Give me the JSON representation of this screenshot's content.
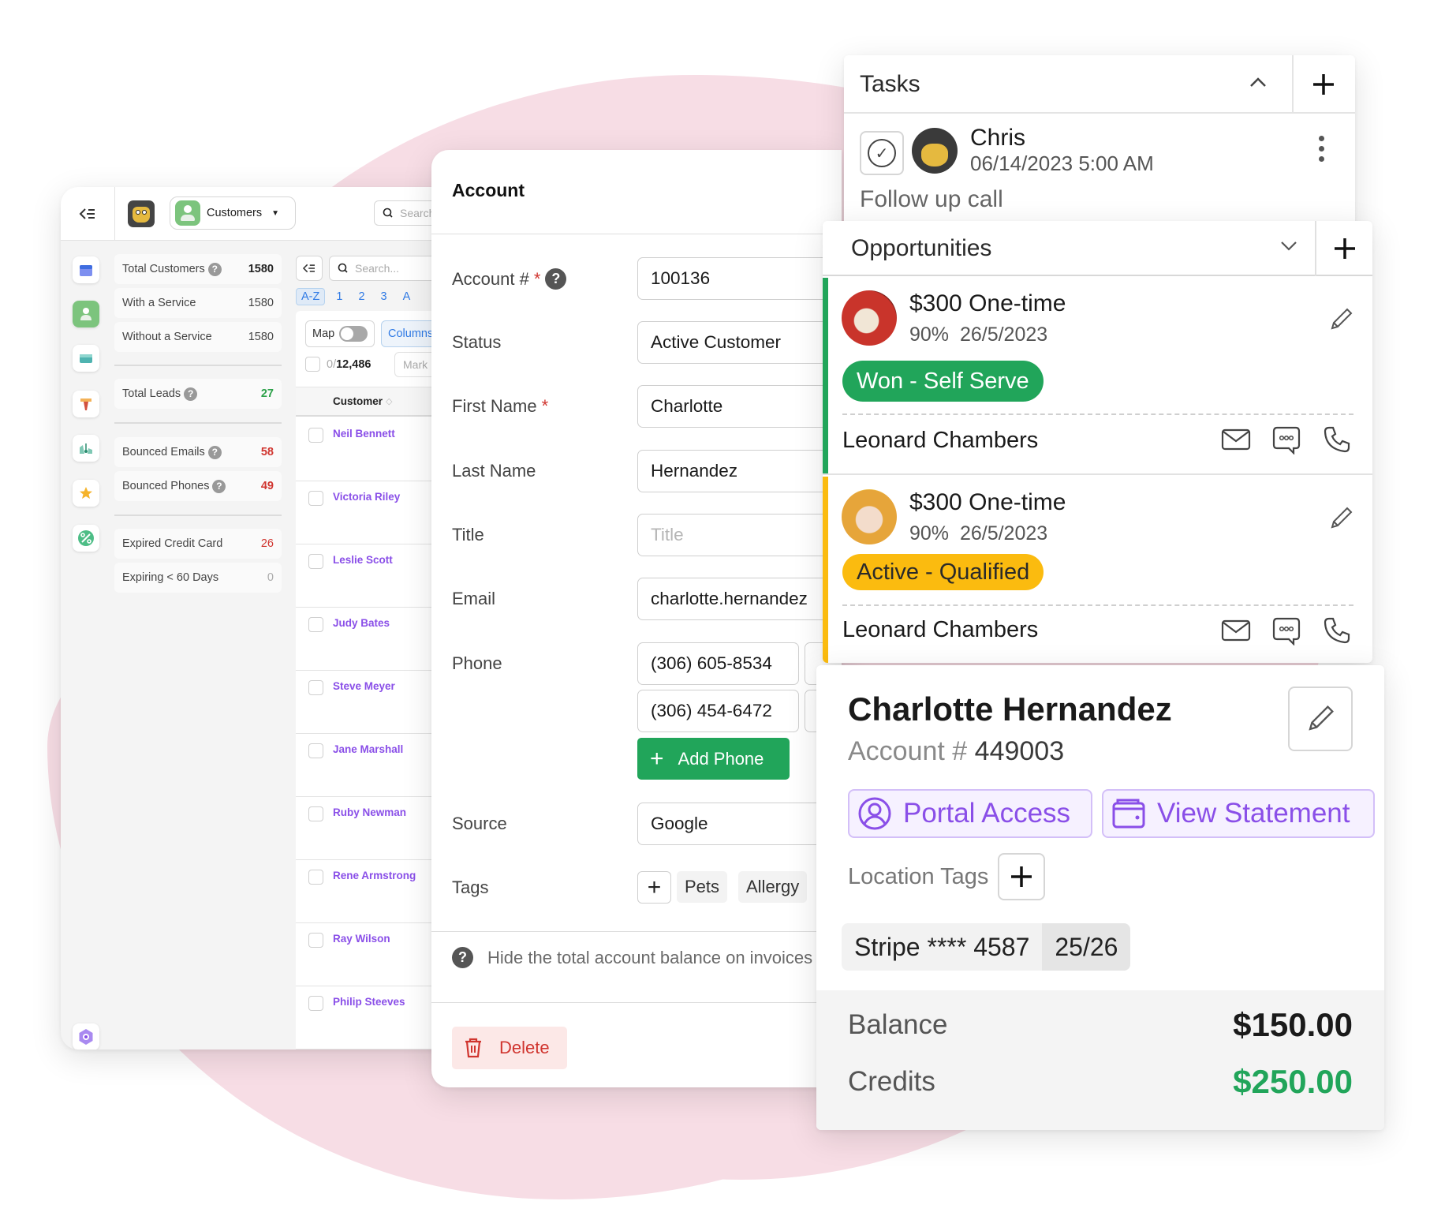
{
  "colors": {
    "accent_purple": "#8a4fe8",
    "success_green": "#21a55a",
    "warning_yellow": "#fbbb0f",
    "danger_red": "#d0352f",
    "link_blue": "#2f7ae5",
    "background_blob": "#f7dde5"
  },
  "left_panel": {
    "collapse_icon": "collapse-left-icon",
    "logo_icon": "gorilla-logo-icon",
    "module_selector": {
      "label": "Customers",
      "icon": "customer-icon",
      "caret": "▼"
    },
    "top_search": {
      "placeholder": "Search"
    },
    "sidebar_icons": [
      {
        "name": "calendar-icon"
      },
      {
        "name": "customers-icon",
        "active": true
      },
      {
        "name": "inbox-icon"
      },
      {
        "name": "funnel-icon"
      },
      {
        "name": "reports-icon"
      },
      {
        "name": "star-icon"
      },
      {
        "name": "percent-icon"
      },
      {
        "name": "settings-icon"
      },
      {
        "name": "tools-icon"
      }
    ],
    "stats": [
      {
        "label": "Total Customers",
        "help": true,
        "value": "1580"
      },
      {
        "label": "With a Service",
        "help": false,
        "value": "1580"
      },
      {
        "label": "Without a Service",
        "help": false,
        "value": "1580"
      },
      {
        "label": "Total Leads",
        "help": true,
        "value": "27"
      },
      {
        "label": "Bounced Emails",
        "help": true,
        "value": "58"
      },
      {
        "label": "Bounced Phones",
        "help": true,
        "value": "49"
      },
      {
        "label": "Expired Credit Card",
        "help": false,
        "value": "26"
      },
      {
        "label": "Expiring < 60 Days",
        "help": false,
        "value": "0"
      }
    ],
    "list": {
      "search_placeholder": "Search...",
      "alpha_filters": [
        "A-Z",
        "1",
        "2",
        "3",
        "A"
      ],
      "map_label": "Map",
      "map_toggle_on": false,
      "columns_label": "Columns",
      "selected_count": "0",
      "total_count": "12,486",
      "mark_label": "Mark",
      "column_header": "Customer",
      "customers": [
        "Neil Bennett",
        "Victoria Riley",
        "Leslie Scott",
        "Judy Bates",
        "Steve Meyer",
        "Jane Marshall",
        "Ruby Newman",
        "Rene Armstrong",
        "Ray Wilson",
        "Philip Steeves"
      ]
    }
  },
  "account_form": {
    "title": "Account",
    "fields": {
      "account_number": {
        "label": "Account #",
        "required": "*",
        "value": "100136"
      },
      "status": {
        "label": "Status",
        "value": "Active Customer"
      },
      "first_name": {
        "label": "First Name",
        "required": "*",
        "value": "Charlotte"
      },
      "last_name": {
        "label": "Last Name",
        "value": "Hernandez"
      },
      "title": {
        "label": "Title",
        "placeholder": "Title",
        "value": ""
      },
      "email": {
        "label": "Email",
        "value": "charlotte.hernandez"
      },
      "phone": {
        "label": "Phone",
        "values": [
          "(306) 605-8534",
          "(306) 454-6472"
        ],
        "add_label": "Add Phone"
      },
      "source": {
        "label": "Source",
        "value": "Google"
      },
      "tags": {
        "label": "Tags",
        "values": [
          "Pets",
          "Allergy"
        ]
      }
    },
    "hint_text": "Hide the total account balance on invoices",
    "delete_label": "Delete"
  },
  "tasks": {
    "title": "Tasks",
    "items": [
      {
        "assignee": "Chris",
        "datetime": "06/14/2023 5:00 AM",
        "description": "Follow up call"
      }
    ]
  },
  "opportunities": {
    "title": "Opportunities",
    "items": [
      {
        "amount": "$300 One-time",
        "probability": "90%",
        "date": "26/5/2023",
        "stage": "Won - Self Serve",
        "stage_color": "#21a55a",
        "contact": "Leonard Chambers"
      },
      {
        "amount": "$300 One-time",
        "probability": "90%",
        "date": "26/5/2023",
        "stage": "Active - Qualified",
        "stage_color": "#fbbb0f",
        "contact": "Leonard Chambers"
      }
    ]
  },
  "customer_card": {
    "name": "Charlotte Hernandez",
    "account_label": "Account #",
    "account_number": "449003",
    "portal_access_label": "Portal Access",
    "view_statement_label": "View Statement",
    "location_tags_label": "Location Tags",
    "payment_method": "Stripe **** 4587",
    "payment_expiry": "25/26",
    "balance_label": "Balance",
    "balance_value": "$150.00",
    "credits_label": "Credits",
    "credits_value": "$250.00"
  }
}
